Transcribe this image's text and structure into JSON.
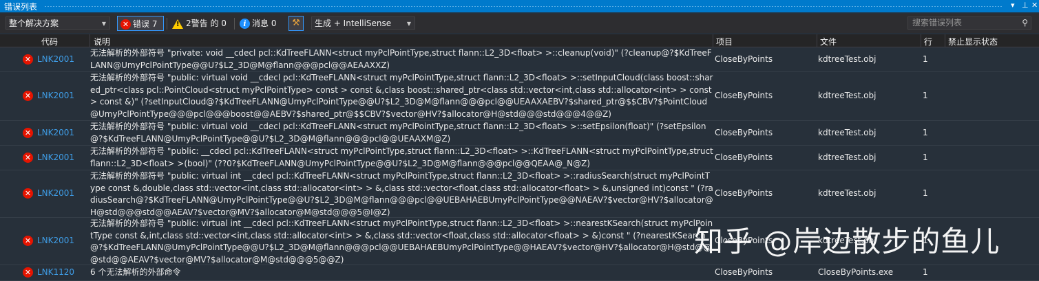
{
  "window": {
    "title": "错误列表",
    "pin": "▾ ⊥ ✕"
  },
  "toolbar": {
    "scope": "整个解决方案",
    "errors_label": "错误 7",
    "warnings_label": "2警告 的 0",
    "messages_label": "消息 0",
    "build_filter": "生成 + IntelliSense",
    "search_placeholder": "搜索错误列表"
  },
  "columns": {
    "code": "代码",
    "desc": "说明",
    "project": "项目",
    "file": "文件",
    "line": "行",
    "suppress": "禁止显示状态"
  },
  "rows": [
    {
      "code": "LNK2001",
      "desc": "无法解析的外部符号 \"private: void __cdecl pcl::KdTreeFLANN<struct myPclPointType,struct flann::L2_3D<float> >::cleanup(void)\" (?cleanup@?$KdTreeFLANN@UmyPclPointType@@U?$L2_3D@M@flann@@@pcl@@AEAAXXZ)",
      "project": "CloseByPoints",
      "file": "kdtreeTest.obj",
      "line": "1"
    },
    {
      "code": "LNK2001",
      "desc": "无法解析的外部符号 \"public: virtual void __cdecl pcl::KdTreeFLANN<struct myPclPointType,struct flann::L2_3D<float> >::setInputCloud(class boost::shared_ptr<class pcl::PointCloud<struct myPclPointType> const > const &,class boost::shared_ptr<class std::vector<int,class std::allocator<int> > const > const &)\" (?setInputCloud@?$KdTreeFLANN@UmyPclPointType@@U?$L2_3D@M@flann@@@pcl@@UEAAXAEBV?$shared_ptr@$$CBV?$PointCloud@UmyPclPointType@@@pcl@@@boost@@AEBV?$shared_ptr@$$CBV?$vector@HV?$allocator@H@std@@@std@@@4@@Z)",
      "project": "CloseByPoints",
      "file": "kdtreeTest.obj",
      "line": "1"
    },
    {
      "code": "LNK2001",
      "desc": "无法解析的外部符号 \"public: virtual void __cdecl pcl::KdTreeFLANN<struct myPclPointType,struct flann::L2_3D<float> >::setEpsilon(float)\" (?setEpsilon@?$KdTreeFLANN@UmyPclPointType@@U?$L2_3D@M@flann@@@pcl@@UEAAXM@Z)",
      "project": "CloseByPoints",
      "file": "kdtreeTest.obj",
      "line": "1"
    },
    {
      "code": "LNK2001",
      "desc": "无法解析的外部符号 \"public: __cdecl pcl::KdTreeFLANN<struct myPclPointType,struct flann::L2_3D<float> >::KdTreeFLANN<struct myPclPointType,struct flann::L2_3D<float> >(bool)\" (??0?$KdTreeFLANN@UmyPclPointType@@U?$L2_3D@M@flann@@@pcl@@QEAA@_N@Z)",
      "project": "CloseByPoints",
      "file": "kdtreeTest.obj",
      "line": "1"
    },
    {
      "code": "LNK2001",
      "desc": "无法解析的外部符号 \"public: virtual int __cdecl pcl::KdTreeFLANN<struct myPclPointType,struct flann::L2_3D<float> >::radiusSearch(struct myPclPointType const &,double,class std::vector<int,class std::allocator<int> > &,class std::vector<float,class std::allocator<float> > &,unsigned int)const \" (?radiusSearch@?$KdTreeFLANN@UmyPclPointType@@U?$L2_3D@M@flann@@@pcl@@UEBAHAEBUmyPclPointType@@NAEAV?$vector@HV?$allocator@H@std@@@std@@AEAV?$vector@MV?$allocator@M@std@@@5@I@Z)",
      "project": "CloseByPoints",
      "file": "kdtreeTest.obj",
      "line": "1"
    },
    {
      "code": "LNK2001",
      "desc": "无法解析的外部符号 \"public: virtual int __cdecl pcl::KdTreeFLANN<struct myPclPointType,struct flann::L2_3D<float> >::nearestKSearch(struct myPclPointType const &,int,class std::vector<int,class std::allocator<int> > &,class std::vector<float,class std::allocator<float> > &)const \" (?nearestKSearch@?$KdTreeFLANN@UmyPclPointType@@U?$L2_3D@M@flann@@@pcl@@UEBAHAEBUmyPclPointType@@HAEAV?$vector@HV?$allocator@H@std@@@std@@AEAV?$vector@MV?$allocator@M@std@@@5@@Z)",
      "project": "CloseByPoints",
      "file": "kdtreeTest.obj",
      "line": "1"
    },
    {
      "code": "LNK1120",
      "desc": "6 个无法解析的外部命令",
      "project": "CloseByPoints",
      "file": "CloseByPoints.exe",
      "line": "1"
    }
  ],
  "watermark": "知乎 @岸边散步的鱼儿",
  "colors": {
    "accent": "#007acc",
    "error": "#e51400",
    "code_link": "#3f9ee8"
  }
}
